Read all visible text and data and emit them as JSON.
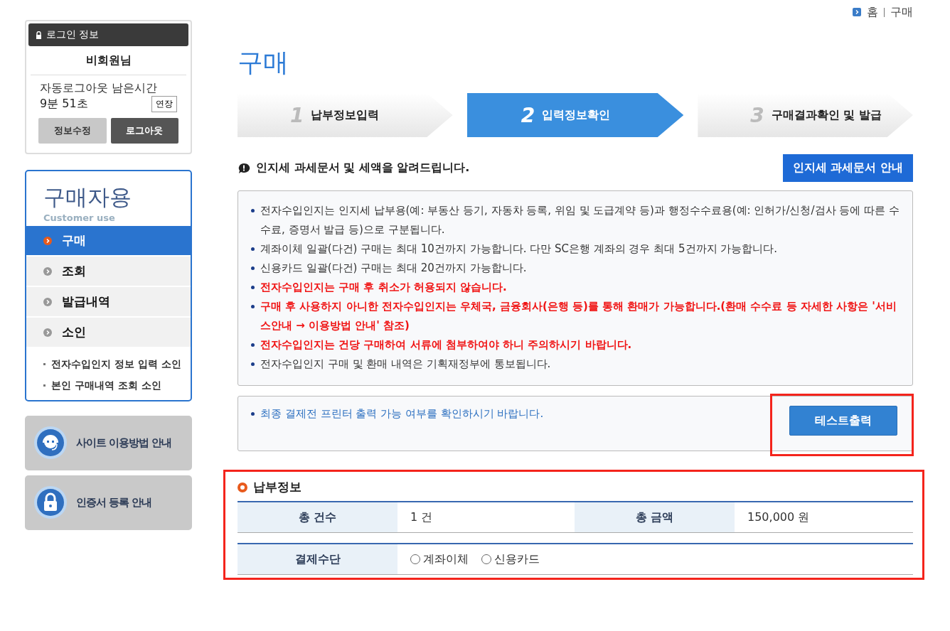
{
  "breadcrumb": [
    "홈",
    "구매"
  ],
  "login": {
    "title": "로그인 정보",
    "user": "비회원님",
    "timer_label": "자동로그아웃 남은시간",
    "timer": "9분 51초",
    "extend": "연장",
    "buttons": [
      "정보수정",
      "로그아웃"
    ]
  },
  "sidebar": {
    "title": "구매자용",
    "subtitle": "Customer use",
    "items": [
      {
        "label": "구매",
        "selected": true
      },
      {
        "label": "조회",
        "selected": false
      },
      {
        "label": "발급내역",
        "selected": false
      },
      {
        "label": "소인",
        "selected": false
      }
    ],
    "sub_items": [
      "전자수입인지 정보 입력 소인",
      "본인 구매내역 조회 소인"
    ]
  },
  "banners": [
    {
      "kind": "support",
      "label": "사이트 이용방법 안내"
    },
    {
      "kind": "lock",
      "label": "인증서 등록 안내"
    }
  ],
  "page_title": "구매",
  "steps": [
    {
      "number": "1",
      "label": "납부정보입력",
      "selected": false
    },
    {
      "number": "2",
      "label": "입력정보확인",
      "selected": true
    },
    {
      "number": "3",
      "label": "구매결과확인 및 발급",
      "selected": false
    }
  ],
  "notice": {
    "text": "인지세 과세문서 및 세액을 알려드립니다.",
    "button": "인지세 과세문서 안내"
  },
  "info_items": [
    {
      "text": "전자수입인지는 인지세 납부용(예: 부동산 등기, 자동차 등록, 위임 및 도급계약 등)과 행정수수료용(예: 인허가/신청/검사 등에 따른 수수료, 증명서 발급 등)으로 구분됩니다.",
      "emphasis": false
    },
    {
      "text": "계좌이체 일괄(다건) 구매는 최대 10건까지 가능합니다. 다만 SC은행 계좌의 경우 최대 5건까지 가능합니다.",
      "emphasis": false
    },
    {
      "text": "신용카드 일괄(다건) 구매는 최대 20건까지 가능합니다.",
      "emphasis": false
    },
    {
      "text": "전자수입인지는 구매 후 취소가 허용되지 않습니다.",
      "emphasis": true
    },
    {
      "text": "구매 후 사용하지 아니한 전자수입인지는 우체국, 금융회사(은행 등)를 통해 환매가 가능합니다.(환매 수수료 등 자세한 사항은 '서비스안내 → 이용방법 안내' 참조)",
      "emphasis": true
    },
    {
      "text": "전자수입인지는 건당 구매하여 서류에 첨부하여야 하니 주의하시기 바랍니다.",
      "emphasis": true
    },
    {
      "text": "전자수입인지 구매 및 환매 내역은 기획재정부에 통보됩니다.",
      "emphasis": false
    }
  ],
  "print_check": {
    "text": "최종 결제전 프린터 출력 가능 여부를 확인하시기 바랍니다.",
    "button": "테스트출력"
  },
  "payment": {
    "title": "납부정보",
    "total_count_label": "총 건수",
    "total_count": "1 건",
    "total_amount_label": "총 금액",
    "total_amount": "150,000 원",
    "method_label": "결제수단",
    "methods": [
      {
        "label": "계좌이체",
        "selected": false
      },
      {
        "label": "신용카드",
        "selected": false
      }
    ]
  }
}
